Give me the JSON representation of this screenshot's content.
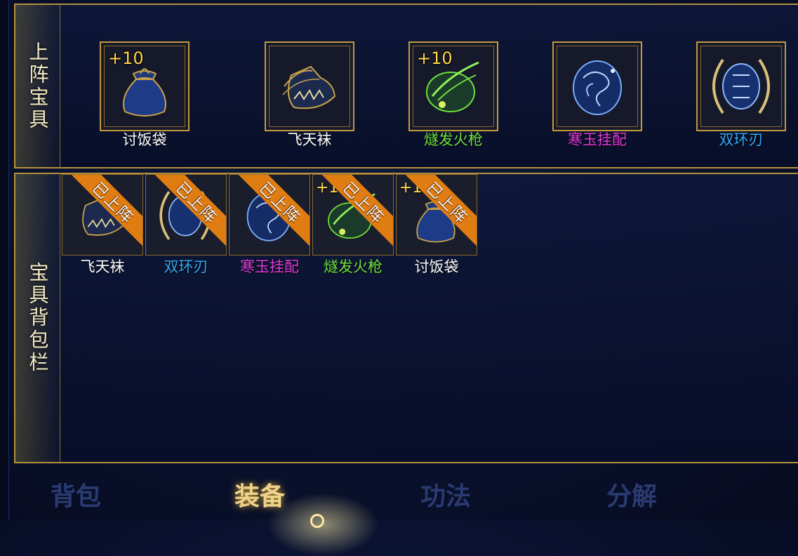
{
  "equipped": {
    "title": "上阵宝具",
    "items": [
      {
        "name": "讨饭袋",
        "plus": "+10",
        "color": "#ffffff",
        "icon": "sack-icon"
      },
      {
        "name": "飞天袜",
        "plus": "",
        "color": "#ffffff",
        "icon": "flying-sock-icon"
      },
      {
        "name": "燧发火枪",
        "plus": "+10",
        "color": "#6de03c",
        "icon": "flintlock-icon"
      },
      {
        "name": "寒玉挂配",
        "plus": "",
        "color": "#e03ad8",
        "icon": "jade-pendant-icon"
      },
      {
        "name": "双环刃",
        "plus": "",
        "color": "#33a8f0",
        "icon": "double-ring-blade-icon"
      }
    ]
  },
  "bag": {
    "title": "宝具背包栏",
    "badge": "已上阵",
    "items": [
      {
        "name": "飞天袜",
        "plus": "",
        "color": "#ffffff",
        "icon": "flying-sock-icon"
      },
      {
        "name": "双环刃",
        "plus": "",
        "color": "#33a8f0",
        "icon": "double-ring-blade-icon"
      },
      {
        "name": "寒玉挂配",
        "plus": "",
        "color": "#e03ad8",
        "icon": "jade-pendant-icon"
      },
      {
        "name": "燧发火枪",
        "plus": "+1",
        "color": "#6de03c",
        "icon": "flintlock-icon"
      },
      {
        "name": "讨饭袋",
        "plus": "+1",
        "color": "#ffffff",
        "icon": "sack-icon"
      }
    ]
  },
  "tabs": [
    {
      "label": "背包",
      "active": false
    },
    {
      "label": "装备",
      "active": true
    },
    {
      "label": "功法",
      "active": false
    },
    {
      "label": "分解",
      "active": false
    }
  ]
}
